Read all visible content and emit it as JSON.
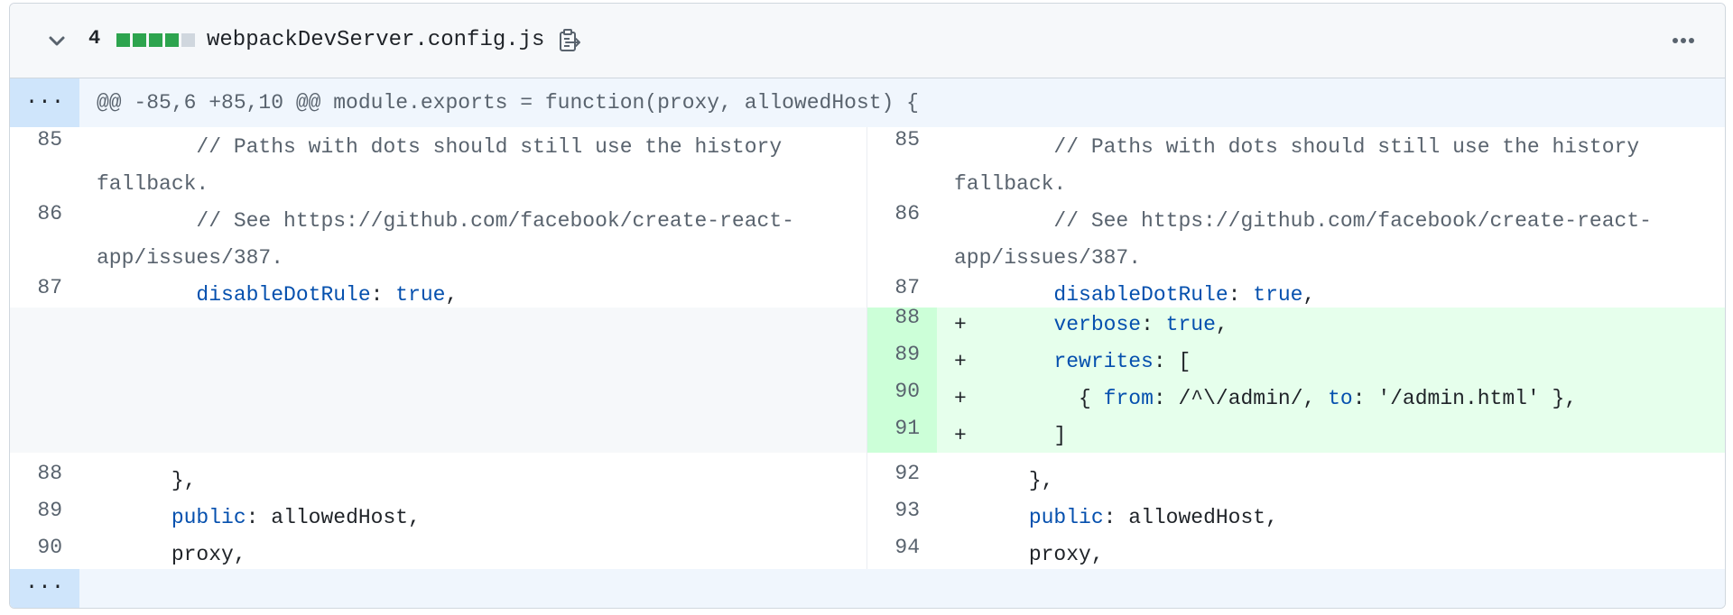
{
  "header": {
    "change_count": "4",
    "file_name": "webpackDevServer.config.js",
    "diffstat_colors": [
      "#2da44e",
      "#2da44e",
      "#2da44e",
      "#2da44e",
      "#d0d7de"
    ],
    "icons": {
      "collapse": "chevron-down-icon",
      "copy": "copy-path-icon",
      "more": "kebab-horizontal-icon"
    }
  },
  "hunk": {
    "expander": "...",
    "header": "@@ -85,6 +85,10 @@ module.exports = function(proxy, allowedHost) {"
  },
  "lines": {
    "l85": "85",
    "l86": "86",
    "l87": "87",
    "l88": "88",
    "l89": "89",
    "l90": "90",
    "r85": "85",
    "r86": "86",
    "r87": "87",
    "r88": "88",
    "r89": "89",
    "r90": "90",
    "r91": "91",
    "r92": "92",
    "r93": "93",
    "r94": "94"
  },
  "code": {
    "c85a": "        // Paths with dots should still use the history",
    "c85b": "fallback.",
    "c86a": "        // See https://github.com/facebook/create-react-",
    "c86b": "app/issues/387.",
    "c87_key": "disableDotRule",
    "c87_sep": ": ",
    "c87_val": "true",
    "c87_end": ",",
    "add_marker": "+",
    "a88_key": "verbose",
    "a88_val": "true",
    "a89_key": "rewrites",
    "a89_rest": ": [",
    "a90_pre": "  { ",
    "a90_from": "from",
    "a90_mid": ": /^\\/admin/, ",
    "a90_to": "to",
    "a90_end": ": '/admin.html' },",
    "a91": "]",
    "c_close": "},",
    "c_public": "public",
    "c_public_rest": ": allowedHost,",
    "c_proxy": "proxy,"
  },
  "bottom": {
    "expander": "..."
  },
  "colors": {
    "addition_bg": "#e6ffec",
    "addition_num_bg": "#ccffd8",
    "hunk_bg": "#f0f6fd",
    "expander_bg": "#cfe5fb",
    "keyword": "#0550ae"
  }
}
